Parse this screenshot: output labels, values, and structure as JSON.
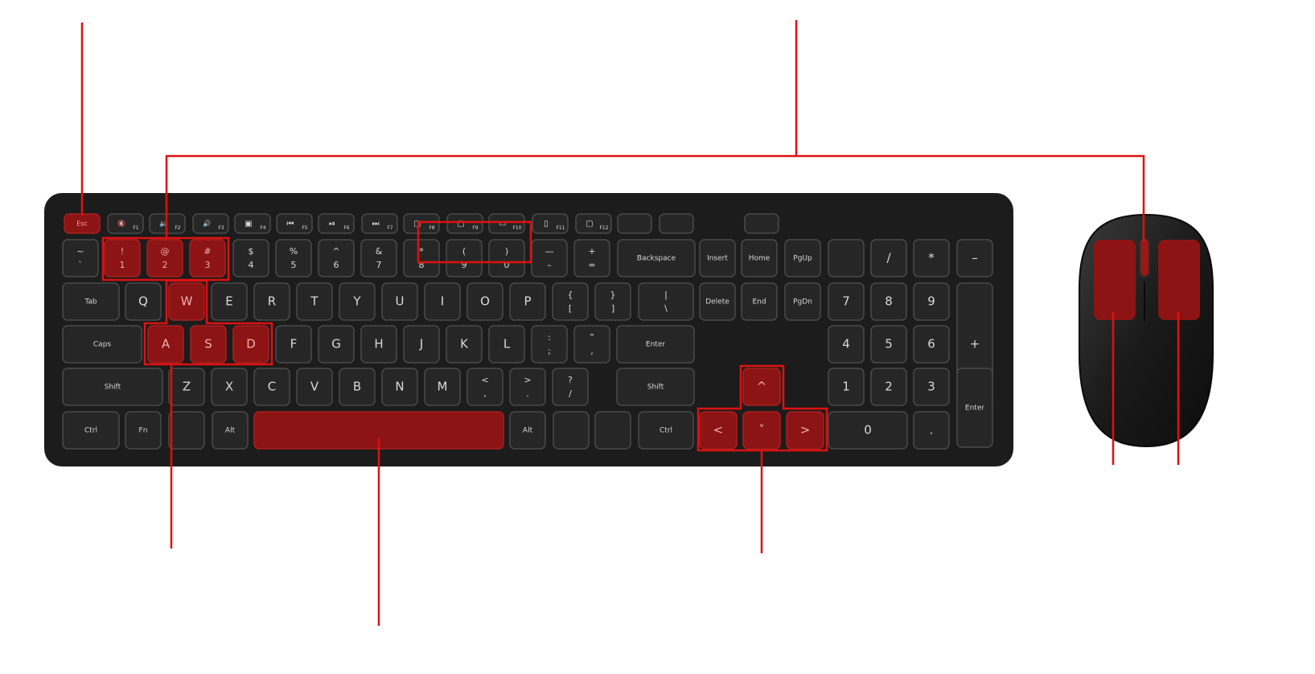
{
  "colors": {
    "body": "#1c1c1c",
    "key": "#262626",
    "key_border": "#4a4a4a",
    "key_text": "#d9d9d9",
    "highlight": "#8c1414",
    "line": "#e01010"
  },
  "keyboard": {
    "fn_row": [
      {
        "main": "Esc",
        "hl": true
      },
      {
        "main": "🔇",
        "sub": "F1"
      },
      {
        "main": "🔉",
        "sub": "F2"
      },
      {
        "main": "🔊",
        "sub": "F3"
      },
      {
        "main": "▣",
        "sub": "F4"
      },
      {
        "main": "⏮",
        "sub": "F5"
      },
      {
        "main": "⏯",
        "sub": "F6"
      },
      {
        "main": "⏭",
        "sub": "F7"
      },
      {
        "main": "▢",
        "sub": "F8"
      },
      {
        "main": "▢",
        "sub": "F9"
      },
      {
        "main": "▭",
        "sub": "F10"
      },
      {
        "main": "▯",
        "sub": "F11"
      },
      {
        "main": "▢",
        "sub": "F12"
      },
      {
        "main": ""
      },
      {
        "main": ""
      },
      {
        "main": ""
      }
    ],
    "number_row": [
      {
        "top": "~",
        "bot": "`"
      },
      {
        "top": "!",
        "bot": "1",
        "hl": true
      },
      {
        "top": "@",
        "bot": "2",
        "hl": true
      },
      {
        "top": "#",
        "bot": "3",
        "hl": true
      },
      {
        "top": "$",
        "bot": "4"
      },
      {
        "top": "%",
        "bot": "5"
      },
      {
        "top": "^",
        "bot": "6"
      },
      {
        "top": "&",
        "bot": "7"
      },
      {
        "top": "*",
        "bot": "8"
      },
      {
        "top": "(",
        "bot": "9"
      },
      {
        "top": ")",
        "bot": "0"
      },
      {
        "top": "—",
        "bot": "–"
      },
      {
        "top": "+",
        "bot": "="
      },
      {
        "main": "Backspace"
      },
      {
        "main": "Insert"
      },
      {
        "main": "Home"
      },
      {
        "main": "PgUp"
      },
      {
        "main": ""
      },
      {
        "main": "/"
      },
      {
        "main": "*"
      },
      {
        "main": "–"
      }
    ],
    "qwerty_row": [
      {
        "main": "Tab"
      },
      {
        "main": "Q"
      },
      {
        "main": "W",
        "hl": true
      },
      {
        "main": "E"
      },
      {
        "main": "R"
      },
      {
        "main": "T"
      },
      {
        "main": "Y"
      },
      {
        "main": "U"
      },
      {
        "main": "I"
      },
      {
        "main": "O"
      },
      {
        "main": "P"
      },
      {
        "top": "{",
        "bot": "["
      },
      {
        "top": "}",
        "bot": "]"
      },
      {
        "top": "|",
        "bot": "\\"
      },
      {
        "main": "Delete"
      },
      {
        "main": "End"
      },
      {
        "main": "PgDn"
      },
      {
        "main": "7"
      },
      {
        "main": "8"
      },
      {
        "main": "9"
      },
      {
        "main": "+"
      }
    ],
    "home_row": [
      {
        "main": "Caps"
      },
      {
        "main": "A",
        "hl": true
      },
      {
        "main": "S",
        "hl": true
      },
      {
        "main": "D",
        "hl": true
      },
      {
        "main": "F"
      },
      {
        "main": "G"
      },
      {
        "main": "H"
      },
      {
        "main": "J"
      },
      {
        "main": "K"
      },
      {
        "main": "L"
      },
      {
        "top": ":",
        "bot": ";"
      },
      {
        "top": "”",
        "bot": ","
      },
      {
        "main": "Enter"
      },
      {
        "main": "4"
      },
      {
        "main": "5"
      },
      {
        "main": "6"
      }
    ],
    "shift_row": [
      {
        "main": "Shift"
      },
      {
        "main": "Z"
      },
      {
        "main": "X"
      },
      {
        "main": "C"
      },
      {
        "main": "V"
      },
      {
        "main": "B"
      },
      {
        "main": "N"
      },
      {
        "main": "M"
      },
      {
        "top": "<",
        "bot": ","
      },
      {
        "top": ">",
        "bot": "."
      },
      {
        "top": "?",
        "bot": "/"
      },
      {
        "main": "Shift"
      },
      {
        "main": "^",
        "hl": true
      },
      {
        "main": "1"
      },
      {
        "main": "2"
      },
      {
        "main": "3"
      },
      {
        "main": "Enter"
      }
    ],
    "bottom_row": [
      {
        "main": "Ctrl"
      },
      {
        "main": "Fn"
      },
      {
        "main": ""
      },
      {
        "main": "Alt"
      },
      {
        "main": "",
        "hl": true
      },
      {
        "main": "Alt"
      },
      {
        "main": ""
      },
      {
        "main": ""
      },
      {
        "main": "Ctrl"
      },
      {
        "main": "<",
        "hl": true
      },
      {
        "main": "˅",
        "hl": true
      },
      {
        "main": ">",
        "hl": true
      },
      {
        "main": "0"
      },
      {
        "main": "."
      }
    ]
  },
  "mouse": {
    "left_button_highlighted": true,
    "right_button_highlighted": true,
    "wheel_highlighted": true
  }
}
